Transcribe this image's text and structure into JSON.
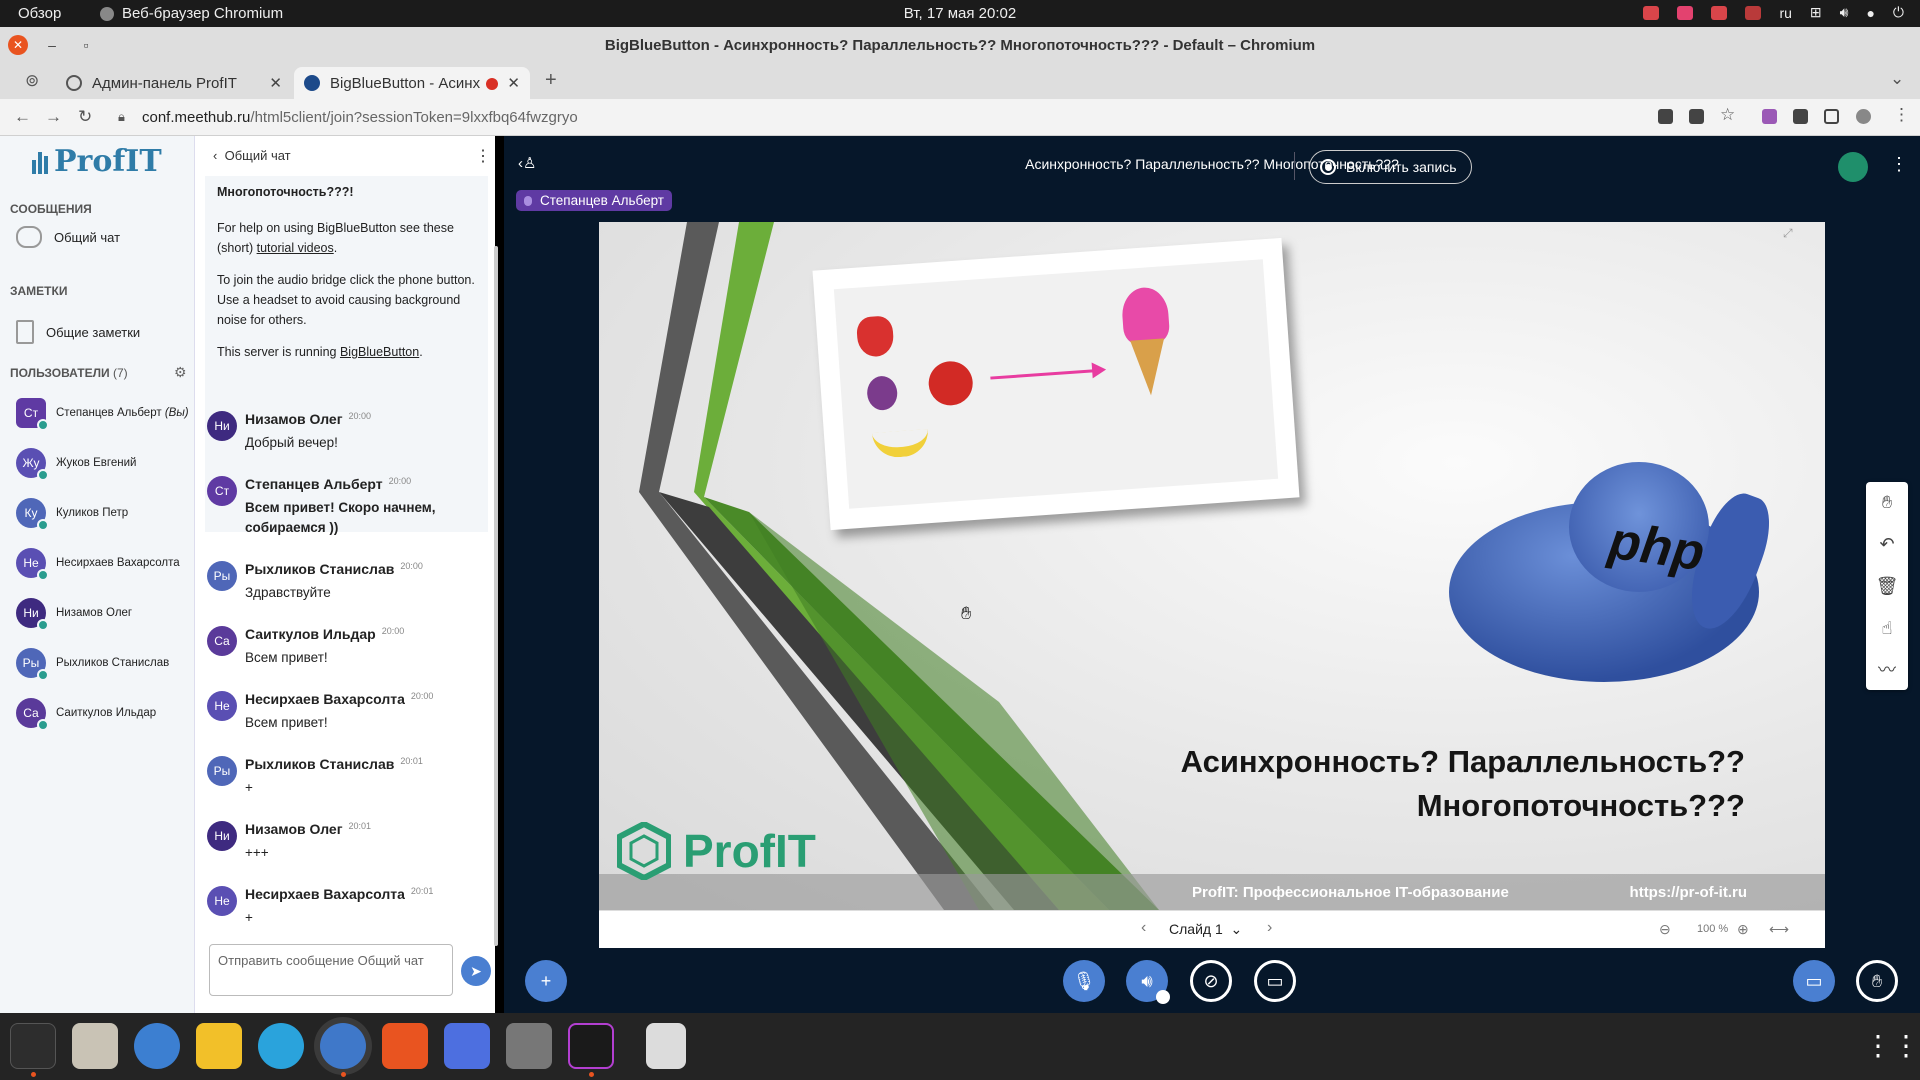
{
  "system": {
    "activities": "Обзор",
    "app_name": "Веб-браузер Chromium",
    "clock": "Вт, 17 мая  20:02",
    "keyboard_layout": "ru"
  },
  "window": {
    "title": "BigBlueButton - Асинхронность? Параллельность?? Многопоточность??? - Default – Chromium"
  },
  "tabs": [
    {
      "label": "Админ-панель ProfIT"
    },
    {
      "label": "BigBlueButton - Асинх"
    }
  ],
  "address": {
    "domain": "conf.meethub.ru",
    "path": "/html5client/join?sessionToken=9lxxfbq64fwzgryo"
  },
  "sidebar": {
    "logo": "ProfIT",
    "messages_header": "СООБЩЕНИЯ",
    "public_chat": "Общий чат",
    "notes_header": "ЗАМЕТКИ",
    "shared_notes": "Общие заметки",
    "users_header": "ПОЛЬЗОВАТЕЛИ",
    "users_count": "(7)",
    "users": [
      {
        "initials": "Ст",
        "name": "Степанцев Альберт",
        "suffix": "(Вы)",
        "color": "#5f3aa3"
      },
      {
        "initials": "Жу",
        "name": "Жуков Евгений",
        "suffix": "",
        "color": "#5a4fb3"
      },
      {
        "initials": "Ку",
        "name": "Куликов Петр",
        "suffix": "",
        "color": "#4f67b8"
      },
      {
        "initials": "Не",
        "name": "Несирхаев Вахарсолта",
        "suffix": "",
        "color": "#5a4fb3"
      },
      {
        "initials": "Ни",
        "name": "Низамов Олег",
        "suffix": "",
        "color": "#3e2a80"
      },
      {
        "initials": "Ры",
        "name": "Рыхликов Станислав",
        "suffix": "",
        "color": "#4f67b8"
      },
      {
        "initials": "Са",
        "name": "Саиткулов Ильдар",
        "suffix": "",
        "color": "#5a3a9a"
      }
    ]
  },
  "chat": {
    "header": "Общий чат",
    "welcome": {
      "line0": "Многопоточность???!",
      "help_pre": "For help on using BigBlueButton see these (short) ",
      "help_link": "tutorial videos",
      "help_post": ".",
      "audio": "To join the audio bridge click the phone button. Use a headset to avoid causing background noise for others.",
      "server_pre": "This server is running ",
      "server_link": "BigBlueButton",
      "server_post": "."
    },
    "messages": [
      {
        "initials": "Ни",
        "name": "Низамов Олег",
        "time": "20:00",
        "text": "Добрый вечер!",
        "bold": false,
        "color": "#3e2a80"
      },
      {
        "initials": "Ст",
        "name": "Степанцев Альберт",
        "time": "20:00",
        "text": "Всем привет! Скоро начнем, собираемся ))",
        "bold": true,
        "color": "#5f3aa3"
      },
      {
        "initials": "Ры",
        "name": "Рыхликов Станислав",
        "time": "20:00",
        "text": "Здравствуйте",
        "bold": false,
        "color": "#4f67b8"
      },
      {
        "initials": "Са",
        "name": "Саиткулов Ильдар",
        "time": "20:00",
        "text": "Всем привет!",
        "bold": false,
        "color": "#5a3a9a"
      },
      {
        "initials": "Не",
        "name": "Несирхаев Вахарсолта",
        "time": "20:00",
        "text": "Всем привет!",
        "bold": false,
        "color": "#5a4fb3"
      },
      {
        "initials": "Ры",
        "name": "Рыхликов Станислав",
        "time": "20:01",
        "text": "+",
        "bold": false,
        "color": "#4f67b8"
      },
      {
        "initials": "Ни",
        "name": "Низамов Олег",
        "time": "20:01",
        "text": "+++",
        "bold": false,
        "color": "#3e2a80"
      },
      {
        "initials": "Не",
        "name": "Несирхаев Вахарсолта",
        "time": "20:01",
        "text": "+",
        "bold": false,
        "color": "#5a4fb3"
      }
    ],
    "input_placeholder": "Отправить сообщение Общий чат"
  },
  "main": {
    "session_title": "Асинхронность? Параллельность?? Многопоточность???",
    "record_button": "Включить запись",
    "presenter_badge": "Степанцев Альберт"
  },
  "slide": {
    "title_line1": "Асинхронность? Параллельность??",
    "title_line2": "Многопоточность???",
    "logo_text": "ProfIT",
    "footer_left": "ProfIT: Профессиональное IT-образование",
    "footer_right": "https://pr-of-it.ru",
    "elephant_label": "php"
  },
  "slide_nav": {
    "label": "Слайд 1",
    "zoom": "100 %"
  },
  "colors": {
    "bbb_bg": "#06172a",
    "accent": "#4a7fd1",
    "presenter": "#5f3aa3",
    "slide_green": "#6cae3a"
  }
}
